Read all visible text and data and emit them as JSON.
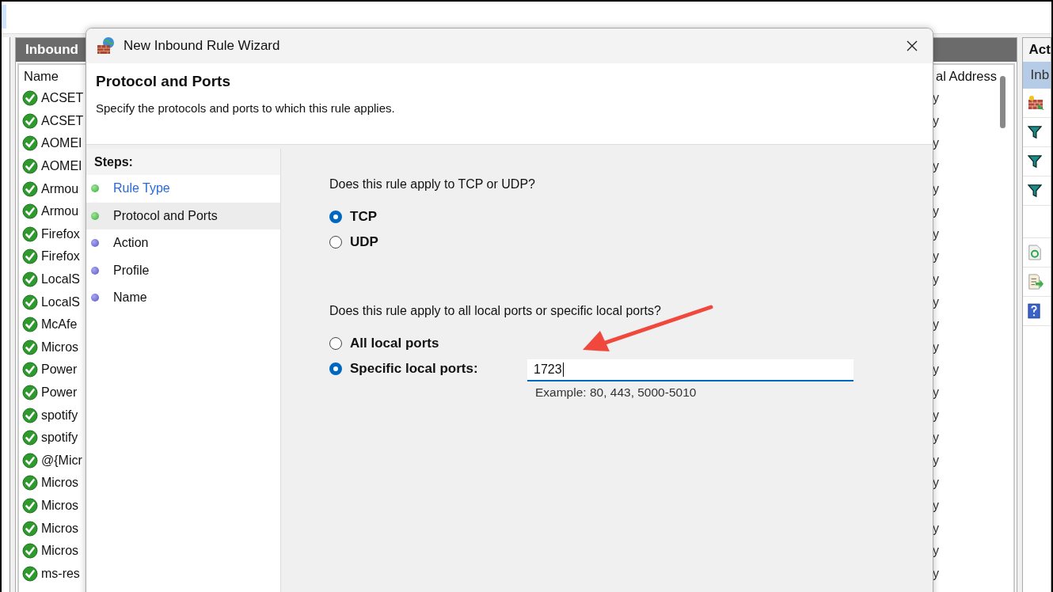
{
  "background": {
    "panel_title": "Inbound",
    "columns": [
      "Name",
      "al Address"
    ],
    "rows": [
      {
        "name": "ACSET",
        "column_2": "y"
      },
      {
        "name": "ACSET",
        "column_2": "y"
      },
      {
        "name": "AOMEI",
        "column_2": "y"
      },
      {
        "name": "AOMEI",
        "column_2": "y"
      },
      {
        "name": "Armou",
        "column_2": "y"
      },
      {
        "name": "Armou",
        "column_2": "y"
      },
      {
        "name": "Firefox",
        "column_2": "y"
      },
      {
        "name": "Firefox",
        "column_2": "y"
      },
      {
        "name": "LocalS",
        "column_2": "y"
      },
      {
        "name": "LocalS",
        "column_2": "y"
      },
      {
        "name": "McAfe",
        "column_2": "y"
      },
      {
        "name": "Micros",
        "column_2": "y"
      },
      {
        "name": "Power",
        "column_2": "y"
      },
      {
        "name": "Power",
        "column_2": "y"
      },
      {
        "name": "spotify",
        "column_2": "y"
      },
      {
        "name": "spotify",
        "column_2": "y"
      },
      {
        "name": "@{Micr",
        "column_2": "y"
      },
      {
        "name": "Micros",
        "column_2": "y"
      },
      {
        "name": "Micros",
        "column_2": "y"
      },
      {
        "name": "Micros",
        "column_2": "y"
      },
      {
        "name": "Micros",
        "column_2": "y"
      },
      {
        "name": "ms-res",
        "column_2": "y"
      }
    ],
    "actions": {
      "title": "Act",
      "selected_item": "Inb"
    }
  },
  "dialog": {
    "title": "New Inbound Rule Wizard",
    "heading": "Protocol and Ports",
    "subtitle": "Specify the protocols and ports to which this rule applies.",
    "steps_title": "Steps:",
    "steps": [
      {
        "label": "Rule Type",
        "completed": true,
        "selected": false
      },
      {
        "label": "Protocol and Ports",
        "completed": true,
        "selected": true
      },
      {
        "label": "Action",
        "completed": false,
        "selected": false
      },
      {
        "label": "Profile",
        "completed": false,
        "selected": false
      },
      {
        "label": "Name",
        "completed": false,
        "selected": false
      }
    ],
    "protocol_question": "Does this rule apply to TCP or UDP?",
    "protocols": [
      {
        "label": "TCP",
        "selected": true
      },
      {
        "label": "UDP",
        "selected": false
      }
    ],
    "ports_question": "Does this rule apply to all local ports or specific local ports?",
    "port_options": [
      {
        "label": "All local ports",
        "selected": false
      },
      {
        "label": "Specific local ports:",
        "selected": true
      }
    ],
    "ports_value": "1723",
    "ports_example": "Example: 80, 443, 5000-5010"
  }
}
